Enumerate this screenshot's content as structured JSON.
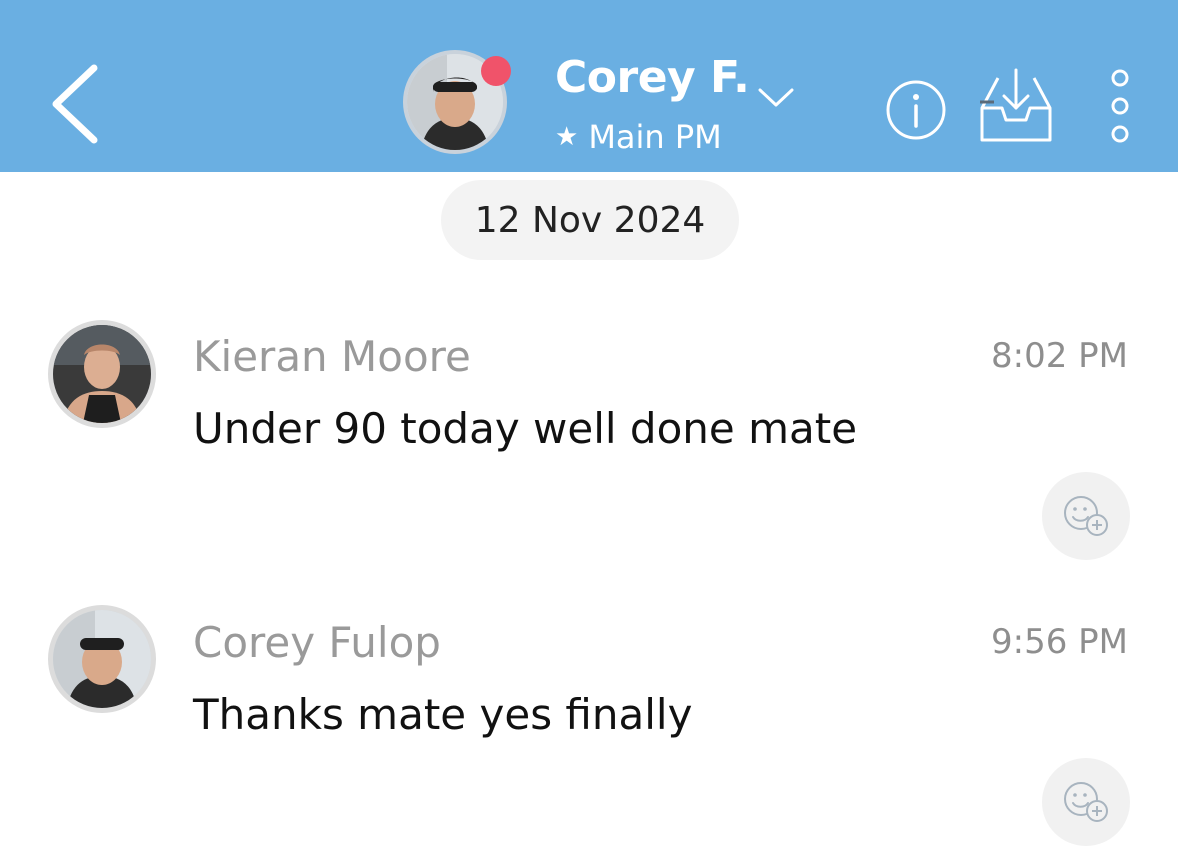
{
  "header": {
    "contact_name": "Corey F.",
    "subtitle": "Main PM",
    "accent_color": "#6aafe2",
    "presence_color": "#f0536a",
    "icons": [
      "back-icon",
      "chevron-down-icon",
      "star-icon",
      "info-icon",
      "inbox-download-icon",
      "more-vertical-icon"
    ]
  },
  "date_divider": "12 Nov 2024",
  "messages": [
    {
      "sender": "Kieran Moore",
      "time": "8:02 PM",
      "text": "Under 90 today well done mate"
    },
    {
      "sender": "Corey Fulop",
      "time": "9:56 PM",
      "text": "Thanks mate yes finally"
    }
  ]
}
